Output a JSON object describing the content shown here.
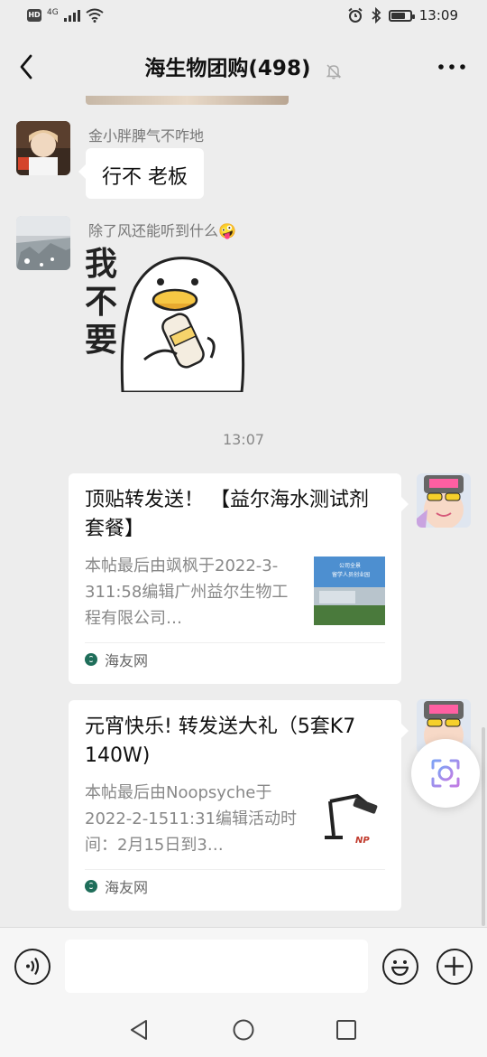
{
  "status_bar": {
    "hd": "HD",
    "network": "4G",
    "time": "13:09",
    "battery_level": 0.7
  },
  "header": {
    "title": "海生物团购(498)"
  },
  "messages": [
    {
      "nickname": "金小胖脾气不咋地",
      "text": "行不 老板"
    },
    {
      "nickname": "除了风还能听到什么🤪",
      "sticker_text": "我不要"
    }
  ],
  "timestamp": "13:07",
  "cards": [
    {
      "title": "顶贴转发送！ 【益尔海水测试剂套餐】",
      "description": "本帖最后由飒枫于2022-3-311:58编辑广州益尔生物工程有限公司…",
      "source": "海友网",
      "thumb_text": "公司全景 留学人员创业园"
    },
    {
      "title": "元宵快乐! 转发送大礼（5套K7 140W)",
      "description": "本帖最后由Noopsyche于2022-2-1511:31编辑活动时间：2月15日到3…",
      "source": "海友网",
      "thumb_text": "NP"
    }
  ],
  "input": {
    "placeholder": ""
  }
}
